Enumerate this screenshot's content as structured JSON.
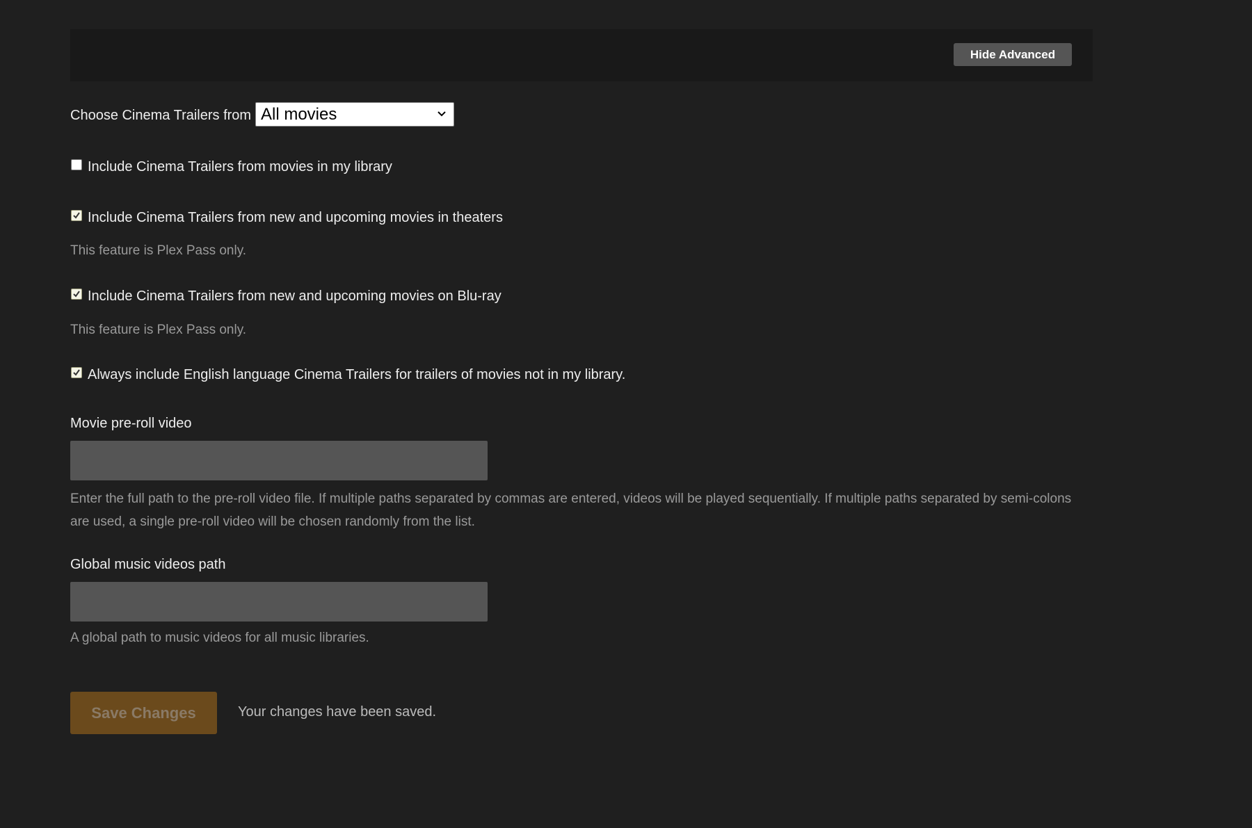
{
  "header": {
    "hide_advanced_label": "Hide Advanced"
  },
  "trailers_source": {
    "label": "Choose Cinema Trailers from",
    "selected": "All movies"
  },
  "options": [
    {
      "label": "Include Cinema Trailers from movies in my library",
      "checked": false
    },
    {
      "label": "Include Cinema Trailers from new and upcoming movies in theaters",
      "checked": true,
      "note": "This feature is Plex Pass only."
    },
    {
      "label": "Include Cinema Trailers from new and upcoming movies on Blu-ray",
      "checked": true,
      "note": "This feature is Plex Pass only."
    },
    {
      "label": "Always include English language Cinema Trailers for trailers of movies not in my library.",
      "checked": true
    }
  ],
  "preroll": {
    "label": "Movie pre-roll video",
    "value": "",
    "help": "Enter the full path to the pre-roll video file. If multiple paths separated by commas are entered, videos will be played sequentially. If multiple paths separated by semi-colons are used, a single pre-roll video will be chosen randomly from the list."
  },
  "music_videos": {
    "label": "Global music videos path",
    "value": "",
    "help": "A global path to music videos for all music libraries."
  },
  "footer": {
    "save_label": "Save Changes",
    "status": "Your changes have been saved."
  },
  "colors": {
    "background": "#1f1f1f",
    "header_bar": "#191919",
    "save_button": "#6b4a1c",
    "input_bg": "#555555"
  }
}
